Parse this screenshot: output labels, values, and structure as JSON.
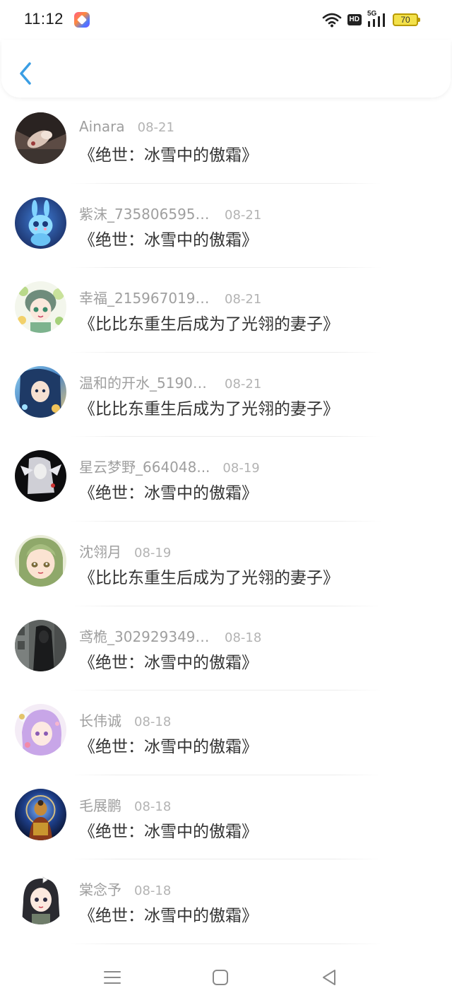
{
  "status_bar": {
    "time": "11:12",
    "hd_label": "HD",
    "network_label": "5G",
    "battery_level": "70"
  },
  "header": {
    "back_icon": "chevron-left-icon",
    "accent_color": "#3a9ee4"
  },
  "items": [
    {
      "user": "Ainara",
      "date": "08-21",
      "book": "《绝世：冰雪中的傲霜》"
    },
    {
      "user": "紫沫_7358065957...",
      "date": "08-21",
      "book": "《绝世：冰雪中的傲霜》"
    },
    {
      "user": "幸福_2159670193...",
      "date": "08-21",
      "book": "《比比东重生后成为了光翎的妻子》"
    },
    {
      "user": "温和的开水_51901...",
      "date": "08-21",
      "book": "《比比东重生后成为了光翎的妻子》"
    },
    {
      "user": "星云梦野_664048...",
      "date": "08-19",
      "book": "《绝世：冰雪中的傲霜》"
    },
    {
      "user": "沈翎月",
      "date": "08-19",
      "book": "《比比东重生后成为了光翎的妻子》"
    },
    {
      "user": "鸢桅_3029293490...",
      "date": "08-18",
      "book": "《绝世：冰雪中的傲霜》"
    },
    {
      "user": "长伟诚",
      "date": "08-18",
      "book": "《绝世：冰雪中的傲霜》"
    },
    {
      "user": "毛展鹏",
      "date": "08-18",
      "book": "《绝世：冰雪中的傲霜》"
    },
    {
      "user": "棠念予",
      "date": "08-18",
      "book": "《绝世：冰雪中的傲霜》"
    }
  ],
  "nav": {
    "menu_icon": "menu-icon",
    "home_icon": "home-square-icon",
    "back_icon": "back-triangle-icon"
  }
}
